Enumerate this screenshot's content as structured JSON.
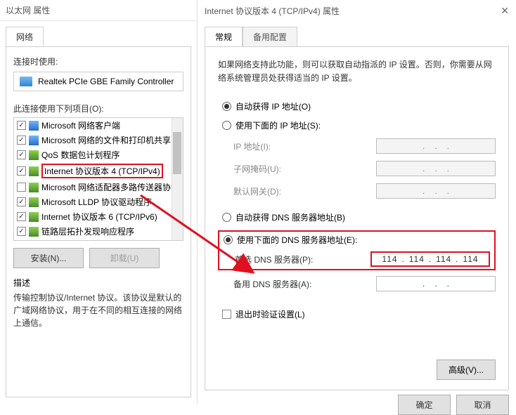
{
  "left": {
    "title": "以太网 属性",
    "tab_network": "网络",
    "connect_using": "连接时使用:",
    "adapter": "Realtek PCIe GBE Family Controller",
    "items_label": "此连接使用下列项目(O):",
    "items": [
      {
        "label": "Microsoft 网络客户端",
        "ico": "blue"
      },
      {
        "label": "Microsoft 网络的文件和打印机共享",
        "ico": "blue"
      },
      {
        "label": "QoS 数据包计划程序",
        "ico": "green"
      },
      {
        "label": "Internet 协议版本 4 (TCP/IPv4)",
        "ico": "green",
        "hl": true
      },
      {
        "label": "Microsoft 网络适配器多路传送器协议",
        "ico": "green",
        "unchecked": true
      },
      {
        "label": "Microsoft LLDP 协议驱动程序",
        "ico": "green"
      },
      {
        "label": "Internet 协议版本 6 (TCP/IPv6)",
        "ico": "green"
      },
      {
        "label": "链路层拓扑发现响应程序",
        "ico": "green"
      }
    ],
    "install_btn": "安装(N)...",
    "uninstall_btn": "卸载(U)",
    "desc_title": "描述",
    "desc_body": "传输控制协议/Internet 协议。该协议是默认的广域网络协议，用于在不同的相互连接的网络上通信。"
  },
  "right": {
    "title": "Internet 协议版本 4 (TCP/IPv4) 属性",
    "tab_general": "常规",
    "tab_alt": "备用配置",
    "intro": "如果网络支持此功能，则可以获取自动指派的 IP 设置。否则，你需要从网络系统管理员处获得适当的 IP 设置。",
    "r_auto_ip": "自动获得 IP 地址(O)",
    "r_manual_ip": "使用下面的 IP 地址(S):",
    "f_ip": "IP 地址(I):",
    "f_mask": "子网掩码(U):",
    "f_gw": "默认网关(D):",
    "r_auto_dns": "自动获得 DNS 服务器地址(B)",
    "r_manual_dns": "使用下面的 DNS 服务器地址(E):",
    "f_dns1": "首选 DNS 服务器(P):",
    "f_dns2": "备用 DNS 服务器(A):",
    "dns_pref_value": [
      "114",
      "114",
      "114",
      "114"
    ],
    "chk_validate": "退出时验证设置(L)",
    "advanced_btn": "高级(V)...",
    "ok_btn": "确定",
    "cancel_btn": "取消"
  }
}
